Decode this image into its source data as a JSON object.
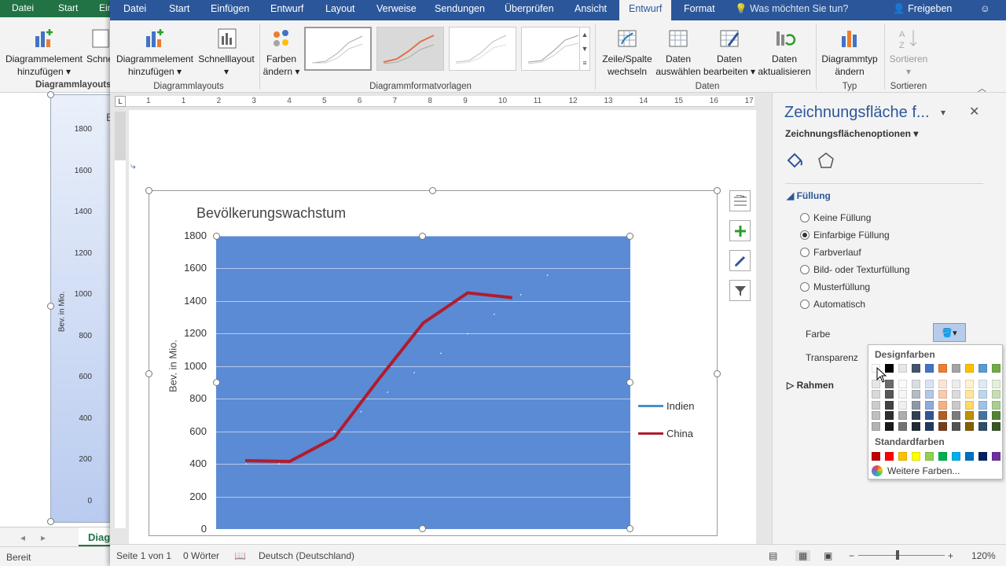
{
  "bg_excel": {
    "tabs": [
      "Datei",
      "Start",
      "Ein"
    ],
    "ribbon_buttons": [
      {
        "label1": "Diagrammelement",
        "label2": "hinzufügen"
      },
      {
        "label1": "Schne",
        "label2": ""
      }
    ],
    "group_label": "Diagrammlayouts",
    "chart_partial_title": "B",
    "y_axis_label": "Bev. in Mio.",
    "y_ticks": [
      "1800",
      "1600",
      "1400",
      "1200",
      "1000",
      "800",
      "600",
      "400",
      "200",
      "0"
    ],
    "sheet_tab": "Diag",
    "status": "Bereit"
  },
  "word": {
    "tabs": [
      "Datei",
      "Start",
      "Einfügen",
      "Entwurf",
      "Layout",
      "Verweise",
      "Sendungen",
      "Überprüfen",
      "Ansicht",
      "Entwurf",
      "Format"
    ],
    "active_tab_index": 9,
    "tell_me": "Was möchten Sie tun?",
    "share": "Freigeben",
    "ribbon": {
      "add_element": {
        "l1": "Diagrammelement",
        "l2": "hinzufügen"
      },
      "quick_layout": {
        "l1": "Schnelllayout",
        "l2": ""
      },
      "change_colors": {
        "l1": "Farben",
        "l2": "ändern"
      },
      "switch_row_col": {
        "l1": "Zeile/Spalte",
        "l2": "wechseln"
      },
      "select_data": {
        "l1": "Daten",
        "l2": "auswählen"
      },
      "edit_data": {
        "l1": "Daten",
        "l2": "bearbeiten"
      },
      "refresh_data": {
        "l1": "Daten",
        "l2": "aktualisieren"
      },
      "chart_type": {
        "l1": "Diagrammtyp",
        "l2": "ändern"
      },
      "sort": {
        "l1": "Sortieren",
        "l2": ""
      },
      "groups": {
        "layouts": "Diagrammlayouts",
        "styles": "Diagrammformatvorlagen",
        "data": "Daten",
        "type": "Typ",
        "sort": "Sortieren"
      }
    },
    "ruler_numbers": [
      "1",
      "1",
      "2",
      "3",
      "4",
      "5",
      "6",
      "7",
      "8",
      "9",
      "10",
      "11",
      "12",
      "13",
      "14",
      "15",
      "16",
      "17"
    ],
    "status": {
      "page": "Seite 1 von 1",
      "words": "0 Wörter",
      "language": "Deutsch (Deutschland)",
      "zoom": "120%"
    }
  },
  "chart_data": {
    "type": "line",
    "title": "Bevölkerungswachstum",
    "ylabel": "Bev. in Mio.",
    "ylim": [
      0,
      1800
    ],
    "yticks": [
      "1800",
      "1600",
      "1400",
      "1200",
      "1000",
      "800",
      "600",
      "400",
      "200",
      "0"
    ],
    "grid": true,
    "legend_position": "right",
    "series": [
      {
        "name": "Indien",
        "color": "#4a90c9",
        "values": [
          400,
          400,
          600,
          800,
          1000,
          1200,
          1400,
          1600
        ]
      },
      {
        "name": "China",
        "color": "#b01c2e",
        "values": [
          420,
          415,
          560,
          920,
          1265,
          1450,
          1420
        ]
      }
    ]
  },
  "pane": {
    "title": "Zeichnungsfläche f...",
    "subtitle": "Zeichnungsflächenoptionen",
    "section_fill": "Füllung",
    "options": [
      "Keine Füllung",
      "Einfarbige Füllung",
      "Farbverlauf",
      "Bild- oder Texturfüllung",
      "Musterfüllung",
      "Automatisch"
    ],
    "selected_option": 1,
    "color_label": "Farbe",
    "transparency_label": "Transparenz",
    "section_border": "Rahmen",
    "palette": {
      "design_label": "Designfarben",
      "standard_label": "Standardfarben",
      "more_colors": "Weitere Farben...",
      "theme_top": [
        "#ffffff",
        "#000000",
        "#e7e6e6",
        "#44546a",
        "#4472c4",
        "#ed7d31",
        "#a5a5a5",
        "#ffc000",
        "#5b9bd5",
        "#70ad47"
      ],
      "standard": [
        "#c00000",
        "#ff0000",
        "#ffc000",
        "#ffff00",
        "#92d050",
        "#00b050",
        "#00b0f0",
        "#0070c0",
        "#002060",
        "#7030a0"
      ]
    }
  }
}
